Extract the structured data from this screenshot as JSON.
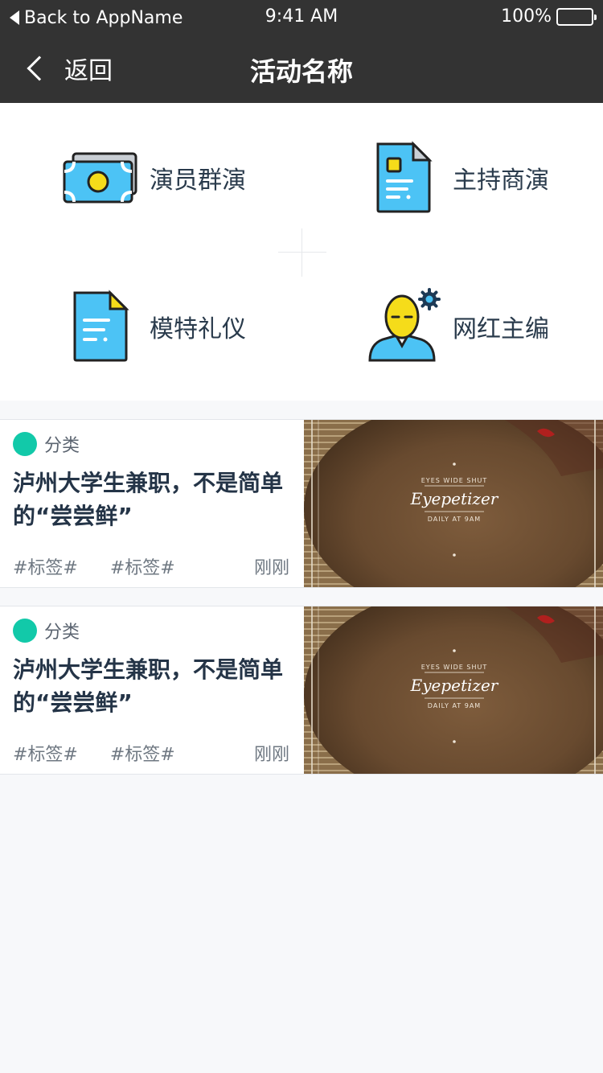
{
  "status_bar": {
    "back_label": "Back to AppName",
    "time": "9:41 AM",
    "battery": "100%"
  },
  "nav": {
    "back_label": "返回",
    "title": "活动名称"
  },
  "categories": [
    {
      "label": "演员群演",
      "icon": "money-bill-icon"
    },
    {
      "label": "主持商演",
      "icon": "document-icon"
    },
    {
      "label": "模特礼仪",
      "icon": "file-icon"
    },
    {
      "label": "网红主编",
      "icon": "user-settings-icon"
    }
  ],
  "articles": [
    {
      "category": "分类",
      "title": "泸州大学生兼职，不是简单的“尝尝鲜”",
      "tags": [
        "#标签#",
        "#标签#"
      ],
      "time": "刚刚",
      "thumb": {
        "line1": "EYES WIDE SHUT",
        "brand": "Eyepetizer",
        "line2": "DAILY AT 9AM"
      }
    },
    {
      "category": "分类",
      "title": "泸州大学生兼职，不是简单的“尝尝鲜”",
      "tags": [
        "#标签#",
        "#标签#"
      ],
      "time": "刚刚",
      "thumb": {
        "line1": "EYES WIDE SHUT",
        "brand": "Eyepetizer",
        "line2": "DAILY AT 9AM"
      }
    }
  ],
  "colors": {
    "header": "#333333",
    "accent_teal": "#12c9a9",
    "icon_blue": "#4cc3f5",
    "icon_yellow": "#f5dc1a"
  }
}
